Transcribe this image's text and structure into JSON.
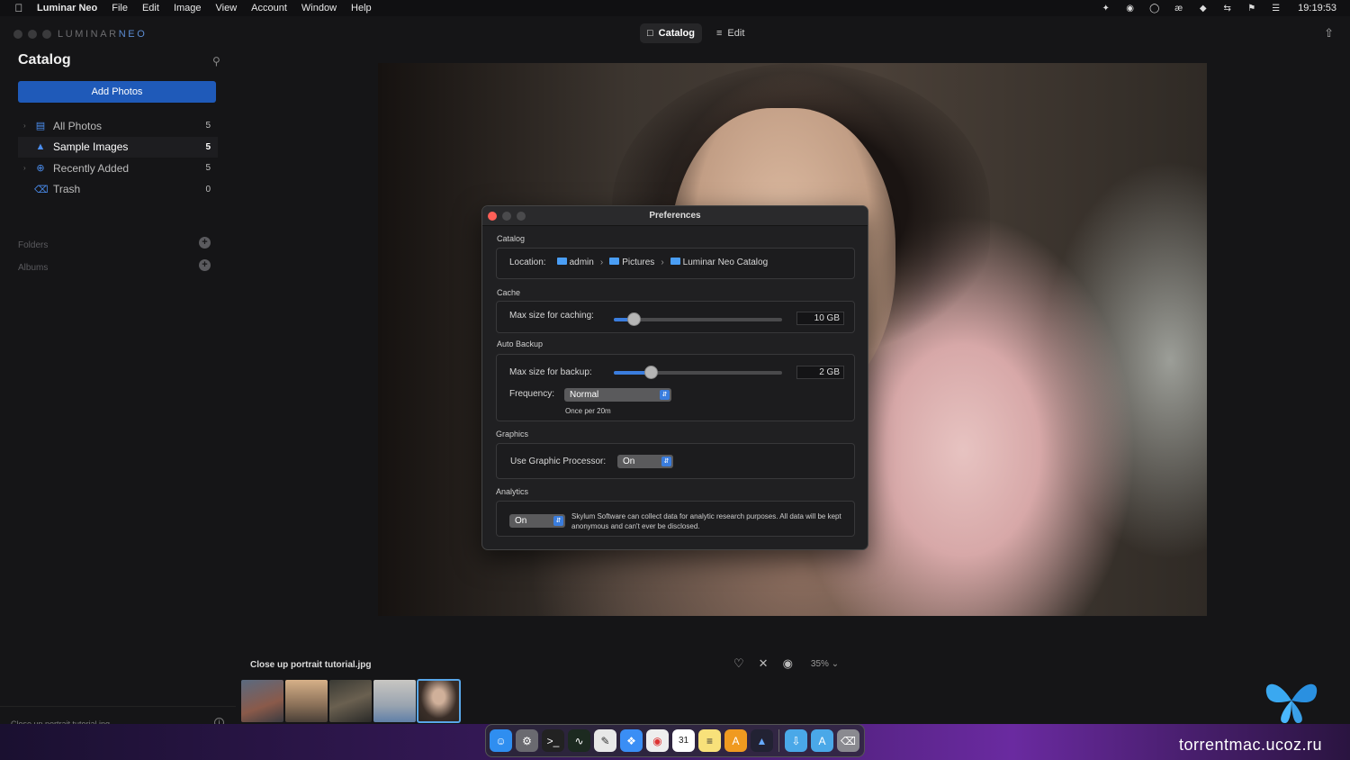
{
  "menubar": {
    "app_name": "Luminar Neo",
    "items": [
      "File",
      "Edit",
      "Image",
      "View",
      "Account",
      "Window",
      "Help"
    ],
    "clock": "19:19:53"
  },
  "window": {
    "brand": "LUMINAR",
    "brand_accent": "NEO",
    "modes": {
      "catalog": "Catalog",
      "edit": "Edit"
    }
  },
  "sidebar": {
    "title": "Catalog",
    "add_photos": "Add Photos",
    "items": [
      {
        "label": "All Photos",
        "count": "5",
        "icon": "stack-icon"
      },
      {
        "label": "Sample Images",
        "count": "5",
        "icon": "graduation-cap-icon"
      },
      {
        "label": "Recently Added",
        "count": "5",
        "icon": "plus-circle-icon"
      },
      {
        "label": "Trash",
        "count": "0",
        "icon": "trash-icon"
      }
    ],
    "folders_label": "Folders",
    "albums_label": "Albums",
    "footer_filename": "Close up portrait tutorial.jpg"
  },
  "viewer": {
    "filename": "Close up portrait tutorial.jpg",
    "zoom": "35%"
  },
  "preferences": {
    "title": "Preferences",
    "catalog": {
      "section": "Catalog",
      "location_label": "Location:",
      "path": [
        "admin",
        "Pictures",
        "Luminar Neo Catalog"
      ]
    },
    "cache": {
      "section": "Cache",
      "label": "Max size for caching:",
      "value": "10 GB",
      "level": 0.12
    },
    "backup": {
      "section": "Auto Backup",
      "label": "Max size for backup:",
      "value": "2 GB",
      "level": 0.22,
      "frequency_label": "Frequency:",
      "frequency_value": "Normal",
      "frequency_note": "Once per 20m"
    },
    "graphics": {
      "section": "Graphics",
      "label": "Use Graphic Processor:",
      "value": "On"
    },
    "analytics": {
      "section": "Analytics",
      "value": "On",
      "text": "Skylum Software can collect data for analytic research purposes. All data will be kept anonymous and can't ever be disclosed."
    }
  },
  "watermark": "torrentmac.ucoz.ru",
  "colors": {
    "accent": "#1f5ab9",
    "blue_icon": "#4b8ef0",
    "close": "#fe5f57"
  }
}
